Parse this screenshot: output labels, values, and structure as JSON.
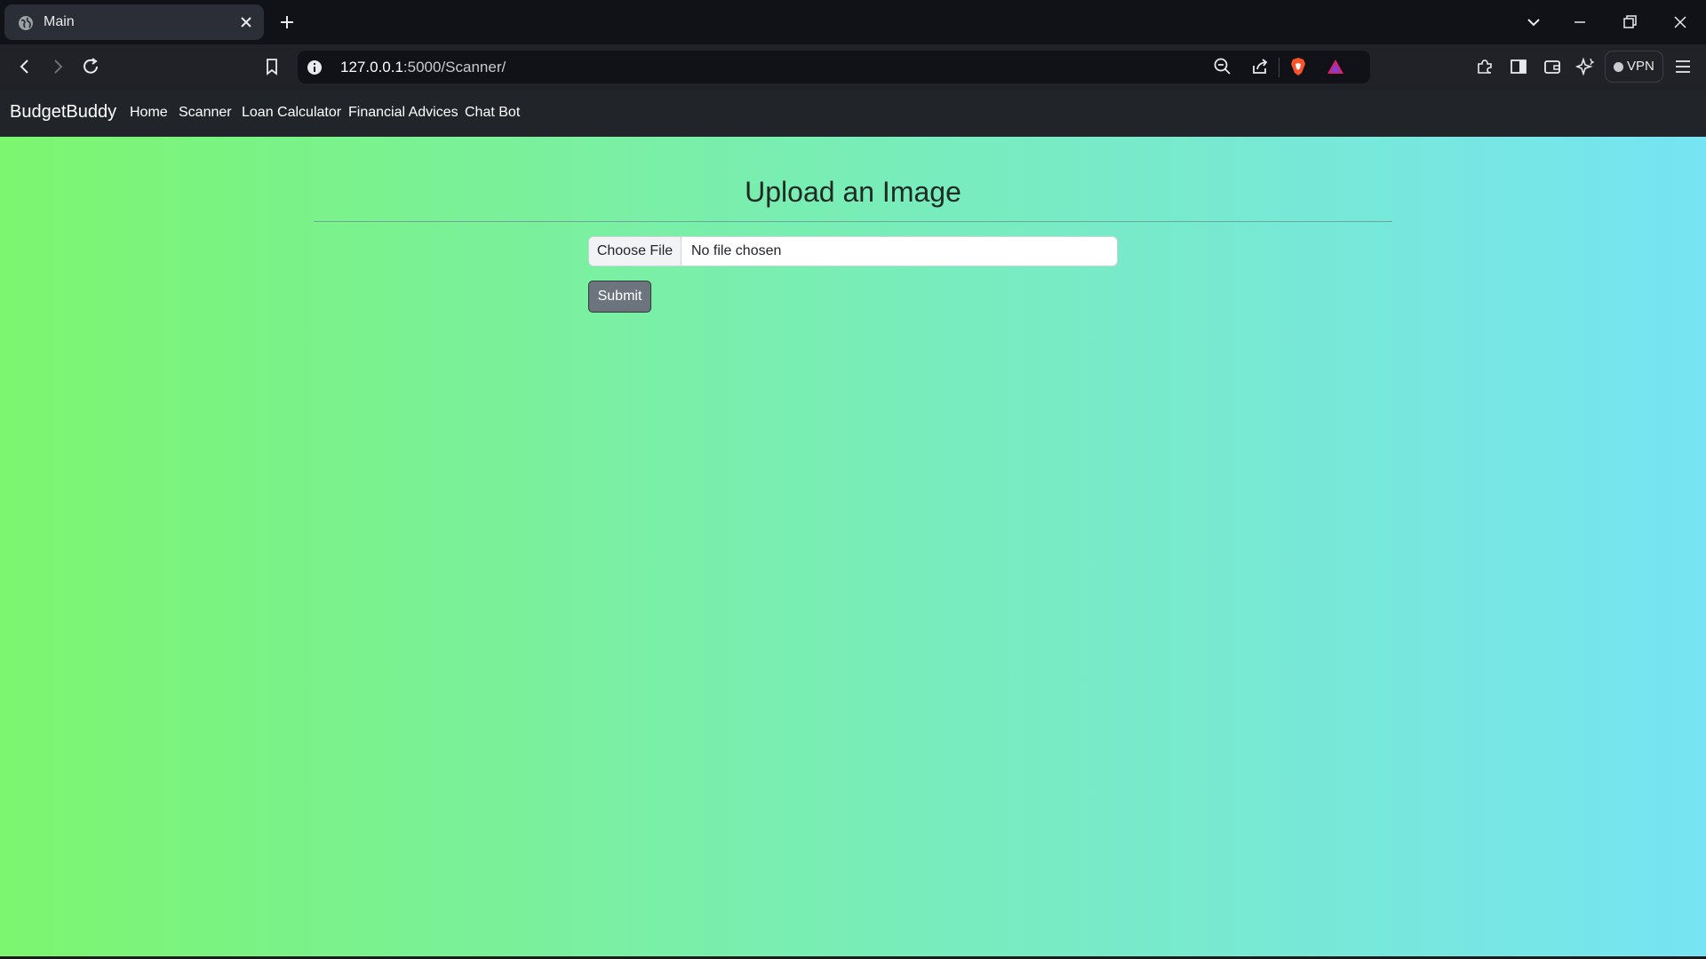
{
  "browser": {
    "tab_title": "Main",
    "url_host": "127.0.0.1",
    "url_path": ":5000/Scanner/",
    "vpn_label": "VPN"
  },
  "navbar": {
    "brand": "BudgetBuddy",
    "links": [
      "Home",
      "Scanner",
      "Loan Calculator",
      "Financial Advices",
      "Chat Bot"
    ]
  },
  "main": {
    "heading": "Upload an Image",
    "file_button": "Choose File",
    "file_status": "No file chosen",
    "submit_label": "Submit"
  },
  "colors": {
    "gradient_start": "#7cf56f",
    "gradient_end": "#76e4f3",
    "navbar_bg": "#212529",
    "submit_bg": "#6c757d"
  }
}
